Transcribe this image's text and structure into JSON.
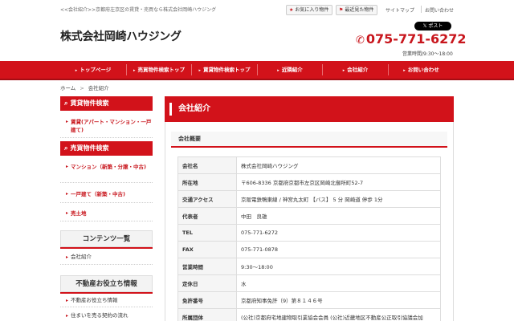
{
  "top": {
    "breadcrumb": "<<会社紹介>>京都府左京区の賃貸・売買なら株式会社岡崎ハウジング",
    "favorites_label": "お気に入り物件",
    "recent_label": "最近見た物件",
    "sitemap_label": "サイトマップ",
    "contact_label": "お問い合わせ"
  },
  "header": {
    "logo": "株式会社岡崎ハウジング",
    "x_post": "𝕏 ポスト",
    "phone": "075-771-6272",
    "hours": "営業時間/9:30～18:00"
  },
  "nav": {
    "items": [
      {
        "label": "トップページ"
      },
      {
        "label": "売買物件検索トップ"
      },
      {
        "label": "賃貸物件検索トップ"
      },
      {
        "label": "近隣紹介"
      },
      {
        "label": "会社紹介"
      },
      {
        "label": "お問い合わせ"
      }
    ]
  },
  "breadcrumb": {
    "home": "ホーム",
    "current": "会社紹介",
    "separator": ">"
  },
  "sidebar": {
    "rental_heading": "賃貸物件検索",
    "rental_items": [
      {
        "label": "賃貸(アパート・マンション・一戸建て)"
      }
    ],
    "sale_heading": "売買物件検索",
    "sale_items": [
      {
        "label": "マンション（新築・分譲・中古)"
      },
      {
        "label": "一戸建て（新築・中古)"
      },
      {
        "label": "売土地"
      }
    ],
    "contents_heading": "コンテンツ一覧",
    "contents_items": [
      {
        "label": "会社紹介"
      }
    ],
    "info_heading": "不動産お役立ち情報",
    "info_items": [
      {
        "label": "不動産お役立ち情報"
      },
      {
        "label": "住まいを売る契約の流れ"
      }
    ]
  },
  "main": {
    "title": "会社紹介",
    "section": "会社概要",
    "rows": [
      {
        "key": "会社名",
        "value": "株式会社岡崎ハウジング"
      },
      {
        "key": "所在地",
        "value": "〒606-8336 京都府京都市左京区岡崎北御所町52-7"
      },
      {
        "key": "交通アクセス",
        "value": "京阪電鉄鴨東線 / 神宮丸太町 【バス】 5 分 岡崎道 停歩 1分"
      },
      {
        "key": "代表者",
        "value": "中田　良雄"
      },
      {
        "key": "TEL",
        "value": "075-771-6272"
      },
      {
        "key": "FAX",
        "value": "075-771-0878"
      },
      {
        "key": "営業時間",
        "value": "9:30～18:00"
      },
      {
        "key": "定休日",
        "value": "水"
      },
      {
        "key": "免許番号",
        "value": "京都府知事免許（9）第８１４６号"
      },
      {
        "key": "所属団体",
        "value": "(公社)京都府宅地建物取引業協会会員 (公社)近畿地区不動産公正取引協議会加"
      }
    ]
  },
  "icons": {
    "star": "star-icon",
    "flag": "flag-icon",
    "phone": "phone-icon",
    "search": "search-icon"
  },
  "colors": {
    "brand_red": "#d2121a"
  }
}
